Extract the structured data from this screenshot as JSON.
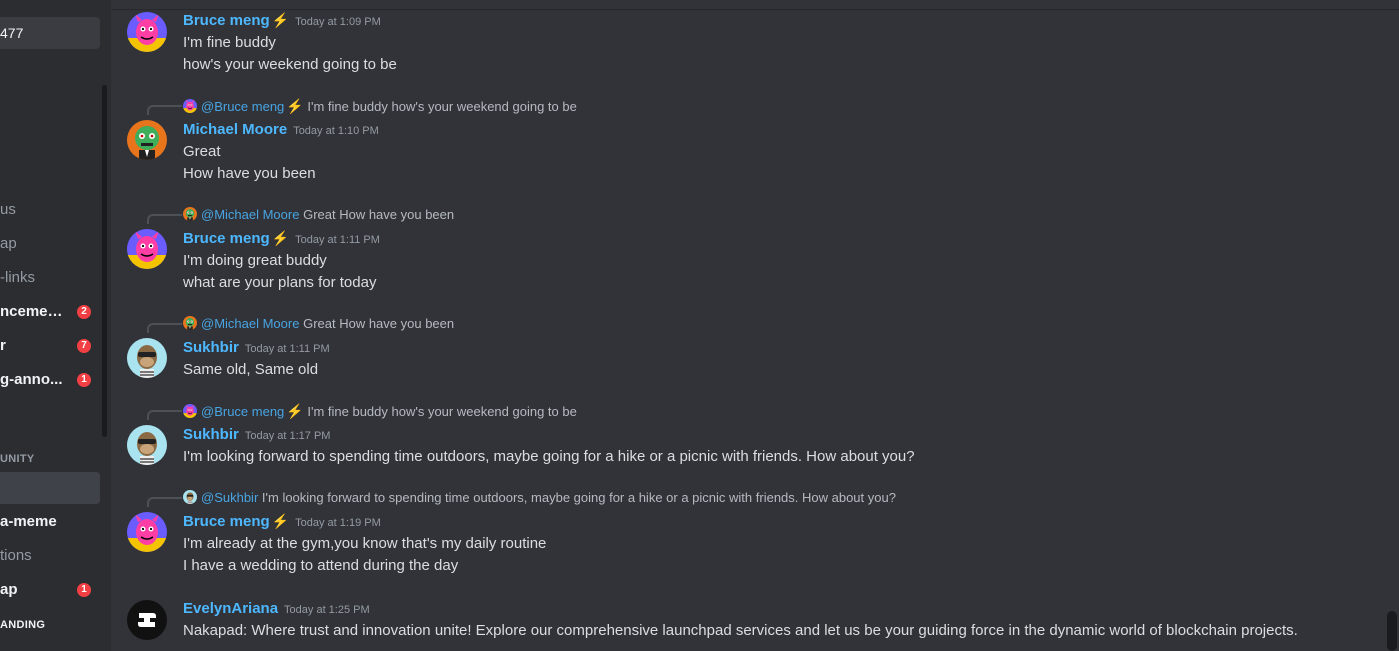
{
  "sidebar": {
    "top_item": "477",
    "channels": [
      {
        "label": "us",
        "unread": false,
        "badge": ""
      },
      {
        "label": "ap",
        "unread": false,
        "badge": ""
      },
      {
        "label": "-links",
        "unread": false,
        "badge": ""
      },
      {
        "label": "ncemen...",
        "unread": true,
        "badge": "2"
      },
      {
        "label": "r",
        "unread": true,
        "badge": "7"
      },
      {
        "label": "g-anno...",
        "unread": true,
        "badge": "1"
      }
    ],
    "category_community": "UNITY",
    "channels2": [
      {
        "label": "",
        "selected": true
      },
      {
        "label": "a-meme",
        "unread": true,
        "badge": ""
      },
      {
        "label": "tions",
        "unread": false,
        "badge": ""
      },
      {
        "label": "ap",
        "unread": true,
        "badge": "1"
      }
    ],
    "category_landing": "ANDING"
  },
  "messages": [
    {
      "author": "Bruce meng",
      "bolt": "⚡",
      "time": "Today at 1:09 PM",
      "avatar": "pink-devil",
      "lines": [
        "I'm fine buddy",
        "how's your weekend going to be"
      ]
    },
    {
      "reply_to": "@Bruce meng",
      "reply_bolt": "⚡",
      "reply_text": "I'm fine buddy how's your weekend going to be",
      "reply_avatar": "pink-devil",
      "author": "Michael Moore",
      "bolt": "",
      "time": "Today at 1:10 PM",
      "avatar": "green-zombie",
      "lines": [
        "Great",
        "How have you been"
      ]
    },
    {
      "reply_to": "@Michael Moore",
      "reply_bolt": "",
      "reply_text": "Great How have you been",
      "reply_avatar": "green-zombie",
      "author": "Bruce meng",
      "bolt": "⚡",
      "time": "Today at 1:11 PM",
      "avatar": "pink-devil",
      "lines": [
        "I'm doing great buddy",
        "what are your plans for today"
      ]
    },
    {
      "reply_to": "@Michael Moore",
      "reply_bolt": "",
      "reply_text": "Great How have you been",
      "reply_avatar": "green-zombie",
      "author": "Sukhbir",
      "bolt": "",
      "time": "Today at 1:11 PM",
      "avatar": "ape",
      "lines": [
        "Same old, Same old"
      ]
    },
    {
      "reply_to": "@Bruce meng",
      "reply_bolt": "⚡",
      "reply_text": "I'm fine buddy how's your weekend going to be",
      "reply_avatar": "pink-devil",
      "author": "Sukhbir",
      "bolt": "",
      "time": "Today at 1:17 PM",
      "avatar": "ape",
      "lines": [
        "I'm looking forward to spending time outdoors, maybe going for a hike or a picnic with friends. How about you?"
      ]
    },
    {
      "reply_to": "@Sukhbir",
      "reply_bolt": "",
      "reply_text": "I'm looking forward to spending time outdoors, maybe going for a hike or a picnic with friends. How about you?",
      "reply_avatar": "ape",
      "author": "Bruce meng",
      "bolt": "⚡",
      "time": "Today at 1:19 PM",
      "avatar": "pink-devil",
      "lines": [
        "I'm already at the gym,you know that's my daily routine",
        "I have a wedding to attend during the day"
      ]
    },
    {
      "author": "EvelynAriana",
      "bolt": "",
      "time": "Today at 1:25 PM",
      "avatar": "nakapad-logo",
      "lines": [
        "Nakapad: Where trust and innovation unite! Explore our comprehensive launchpad services and let us be your guiding force in the dynamic world of blockchain projects."
      ]
    }
  ],
  "colors": {
    "background": "#313338",
    "sidebar": "#2b2d31",
    "username": "#4db8ff",
    "badge": "#f23f43",
    "bolt": "#f0b232"
  }
}
